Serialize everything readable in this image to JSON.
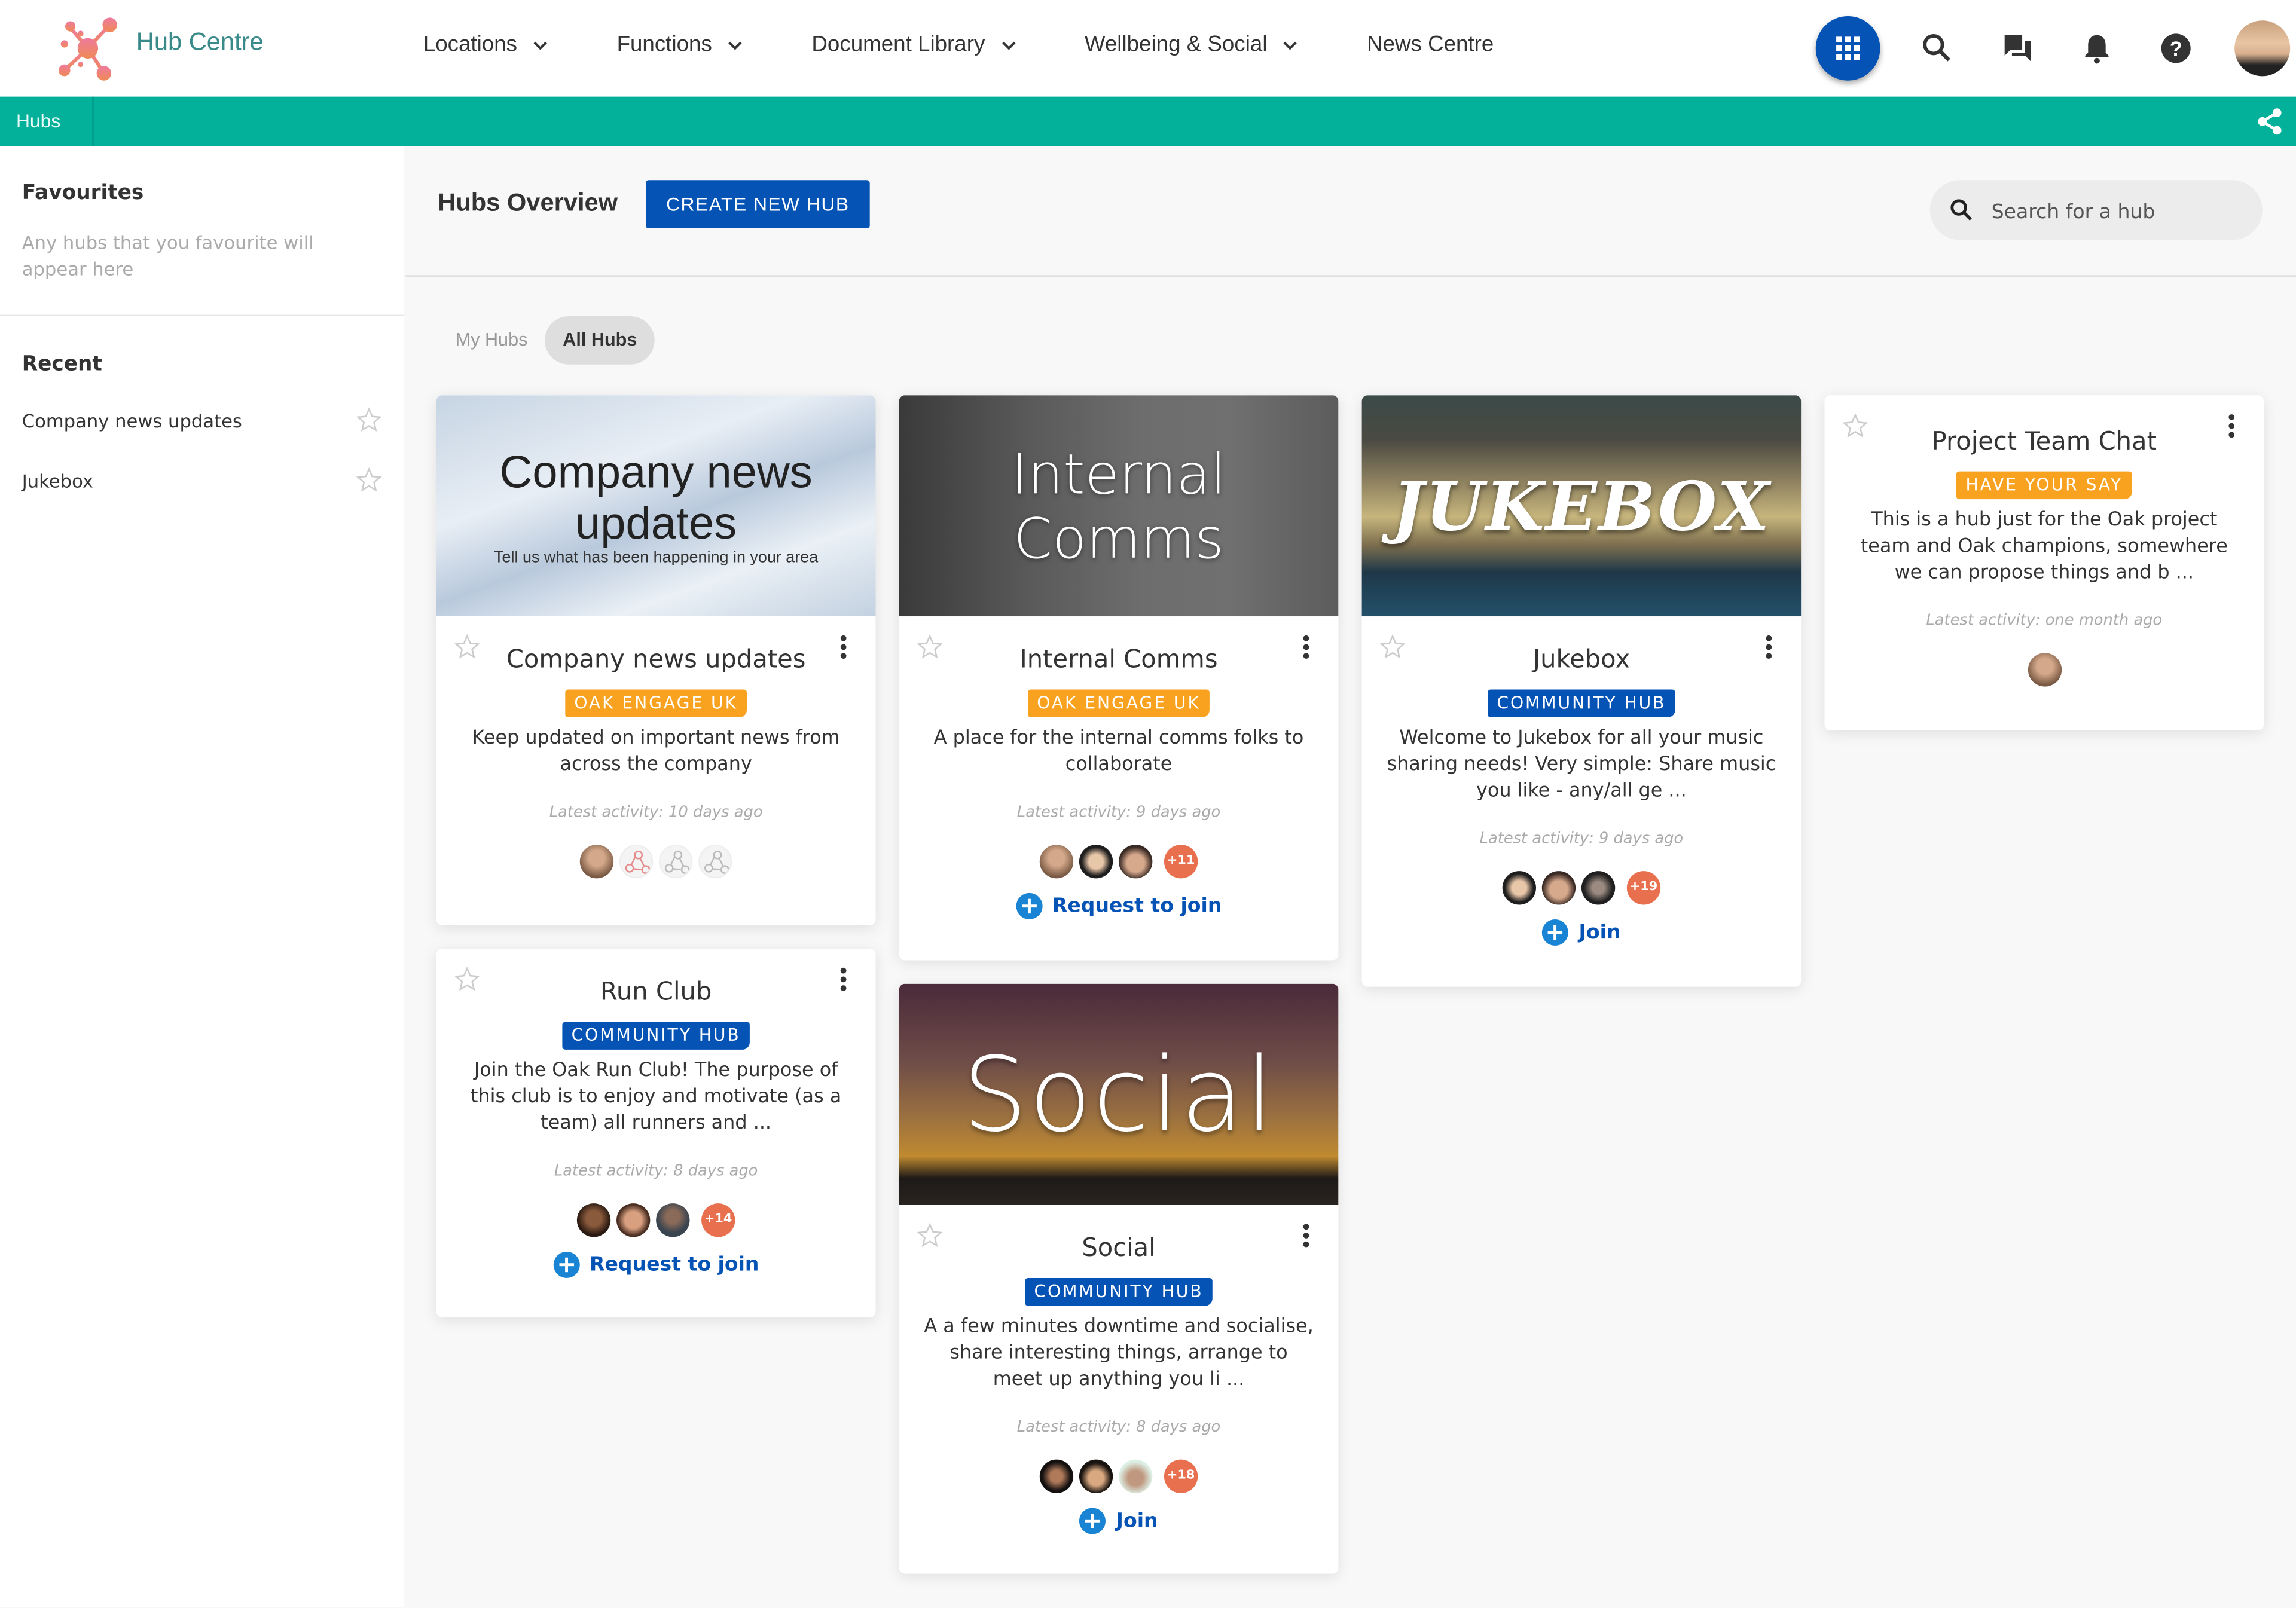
{
  "app": {
    "title": "Hub Centre"
  },
  "nav": {
    "items": [
      {
        "label": "Locations",
        "has_dropdown": true
      },
      {
        "label": "Functions",
        "has_dropdown": true
      },
      {
        "label": "Document Library",
        "has_dropdown": true
      },
      {
        "label": "Wellbeing & Social",
        "has_dropdown": true
      },
      {
        "label": "News Centre",
        "has_dropdown": false
      }
    ],
    "icons": [
      "apps-grid-icon",
      "search-icon",
      "chat-icon",
      "bell-icon",
      "help-icon",
      "user-avatar"
    ]
  },
  "breadcrumb": {
    "label": "Hubs",
    "share_icon": "share-icon"
  },
  "colors": {
    "brand_teal": "#03b09a",
    "primary_blue": "#0553b5",
    "badge_orange": "#f8a21f",
    "member_count": "#e8704f",
    "join_plus": "#1a84d4"
  },
  "sidebar": {
    "favourites_title": "Favourites",
    "favourites_empty": "Any hubs that you favourite will appear here",
    "recent_title": "Recent",
    "recent": [
      {
        "label": "Company news updates"
      },
      {
        "label": "Jukebox"
      }
    ]
  },
  "main": {
    "title": "Hubs Overview",
    "create_button": "CREATE NEW HUB",
    "search_placeholder": "Search for a hub",
    "tabs": [
      {
        "label": "My Hubs",
        "active": false
      },
      {
        "label": "All Hubs",
        "active": true
      }
    ]
  },
  "hubs": [
    {
      "banner_title": "Company news updates",
      "banner_subtitle": "Tell us what has been happening in your area",
      "title": "Company news updates",
      "badge": "OAK ENGAGE UK",
      "badge_color": "orange",
      "description": "Keep updated on important news from across the company",
      "activity": "Latest activity: 10 days ago",
      "member_count_extra": null,
      "action": null
    },
    {
      "banner_title": "Internal Comms",
      "title": "Internal Comms",
      "badge": "OAK ENGAGE UK",
      "badge_color": "orange",
      "description": "A place for the internal comms folks to collaborate",
      "activity": "Latest activity: 9 days ago",
      "member_count_extra": "+11",
      "action": "Request to join"
    },
    {
      "banner_title": "JUKEBOX",
      "title": "Jukebox",
      "badge": "COMMUNITY HUB",
      "badge_color": "blue",
      "description": "Welcome to Jukebox for all your music sharing needs! Very simple: Share music you like - any/all ge ...",
      "activity": "Latest activity: 9 days ago",
      "member_count_extra": "+19",
      "action": "Join"
    },
    {
      "title": "Project Team Chat",
      "badge": "HAVE YOUR SAY",
      "badge_color": "orange",
      "description": "This is a hub just for the Oak project team and Oak champions, somewhere we can propose things and b ...",
      "activity": "Latest activity: one month ago",
      "member_count_extra": null,
      "action": null
    },
    {
      "title": "Run Club",
      "badge": "COMMUNITY HUB",
      "badge_color": "blue",
      "description": "Join the Oak Run Club! The purpose of this club is to enjoy and motivate (as a team) all runners and ...",
      "activity": "Latest activity: 8 days ago",
      "member_count_extra": "+14",
      "action": "Request to join"
    },
    {
      "banner_title": "Social",
      "title": "Social",
      "badge": "COMMUNITY HUB",
      "badge_color": "blue",
      "description": "A a few minutes downtime and socialise, share interesting things, arrange to meet up anything you li ...",
      "activity": "Latest activity: 8 days ago",
      "member_count_extra": "+18",
      "action": "Join"
    }
  ]
}
